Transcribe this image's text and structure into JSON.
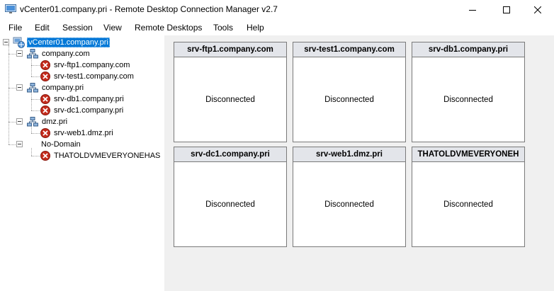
{
  "window": {
    "title": "vCenter01.company.pri - Remote Desktop Connection Manager v2.7"
  },
  "menu": [
    "File",
    "Edit",
    "Session",
    "View",
    "Remote Desktops",
    "Tools",
    "Help"
  ],
  "tree": {
    "root": "vCenter01.company.pri",
    "groups": [
      {
        "label": "company.com",
        "servers": [
          "srv-ftp1.company.com",
          "srv-test1.company.com"
        ]
      },
      {
        "label": "company.pri",
        "servers": [
          "srv-db1.company.pri",
          "srv-dc1.company.pri"
        ]
      },
      {
        "label": "dmz.pri",
        "servers": [
          "srv-web1.dmz.pri"
        ]
      },
      {
        "label": "No-Domain",
        "servers": [
          "THATOLDVMEVERYONEHAS"
        ]
      }
    ]
  },
  "thumbnails": [
    {
      "title": "srv-ftp1.company.com",
      "status": "Disconnected"
    },
    {
      "title": "srv-test1.company.com",
      "status": "Disconnected"
    },
    {
      "title": "srv-db1.company.pri",
      "status": "Disconnected"
    },
    {
      "title": "srv-dc1.company.pri",
      "status": "Disconnected"
    },
    {
      "title": "srv-web1.dmz.pri",
      "status": "Disconnected"
    },
    {
      "title": "THATOLDVMEVERYONEH",
      "status": "Disconnected"
    }
  ],
  "icons": {
    "app": "rdcman-app-icon",
    "server": "disconnected-server-icon",
    "group": "server-group-icon",
    "root": "connection-file-icon"
  },
  "colors": {
    "selection": "#0078d7",
    "card_header": "#e3e5ea",
    "content_bg": "#f0f0f0",
    "disconnected_icon": "#c42b1c"
  }
}
